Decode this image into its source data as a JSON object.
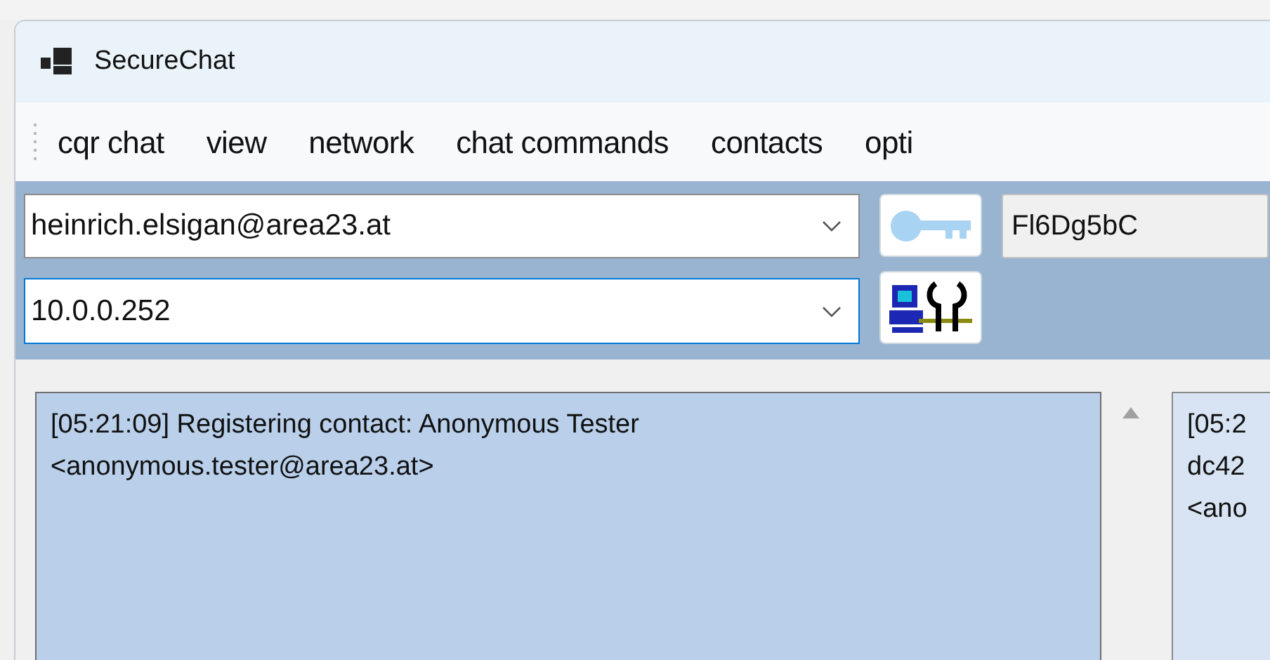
{
  "window": {
    "title": "SecureChat"
  },
  "menu": [
    "cqr chat",
    "view",
    "network",
    "chat commands",
    "contacts",
    "opti"
  ],
  "toolbar": {
    "contact": {
      "value": "heinrich.elsigan@area23.at"
    },
    "address": {
      "value": "10.0.0.252",
      "focused": true
    },
    "key_code": "Fl6Dg5bC"
  },
  "log": {
    "lines": [
      "[05:21:09] Registering contact: Anonymous Tester",
      "<anonymous.tester@area23.at>"
    ]
  },
  "peer_log": {
    "lines": [
      "[05:2",
      "dc42",
      "<ano"
    ]
  }
}
